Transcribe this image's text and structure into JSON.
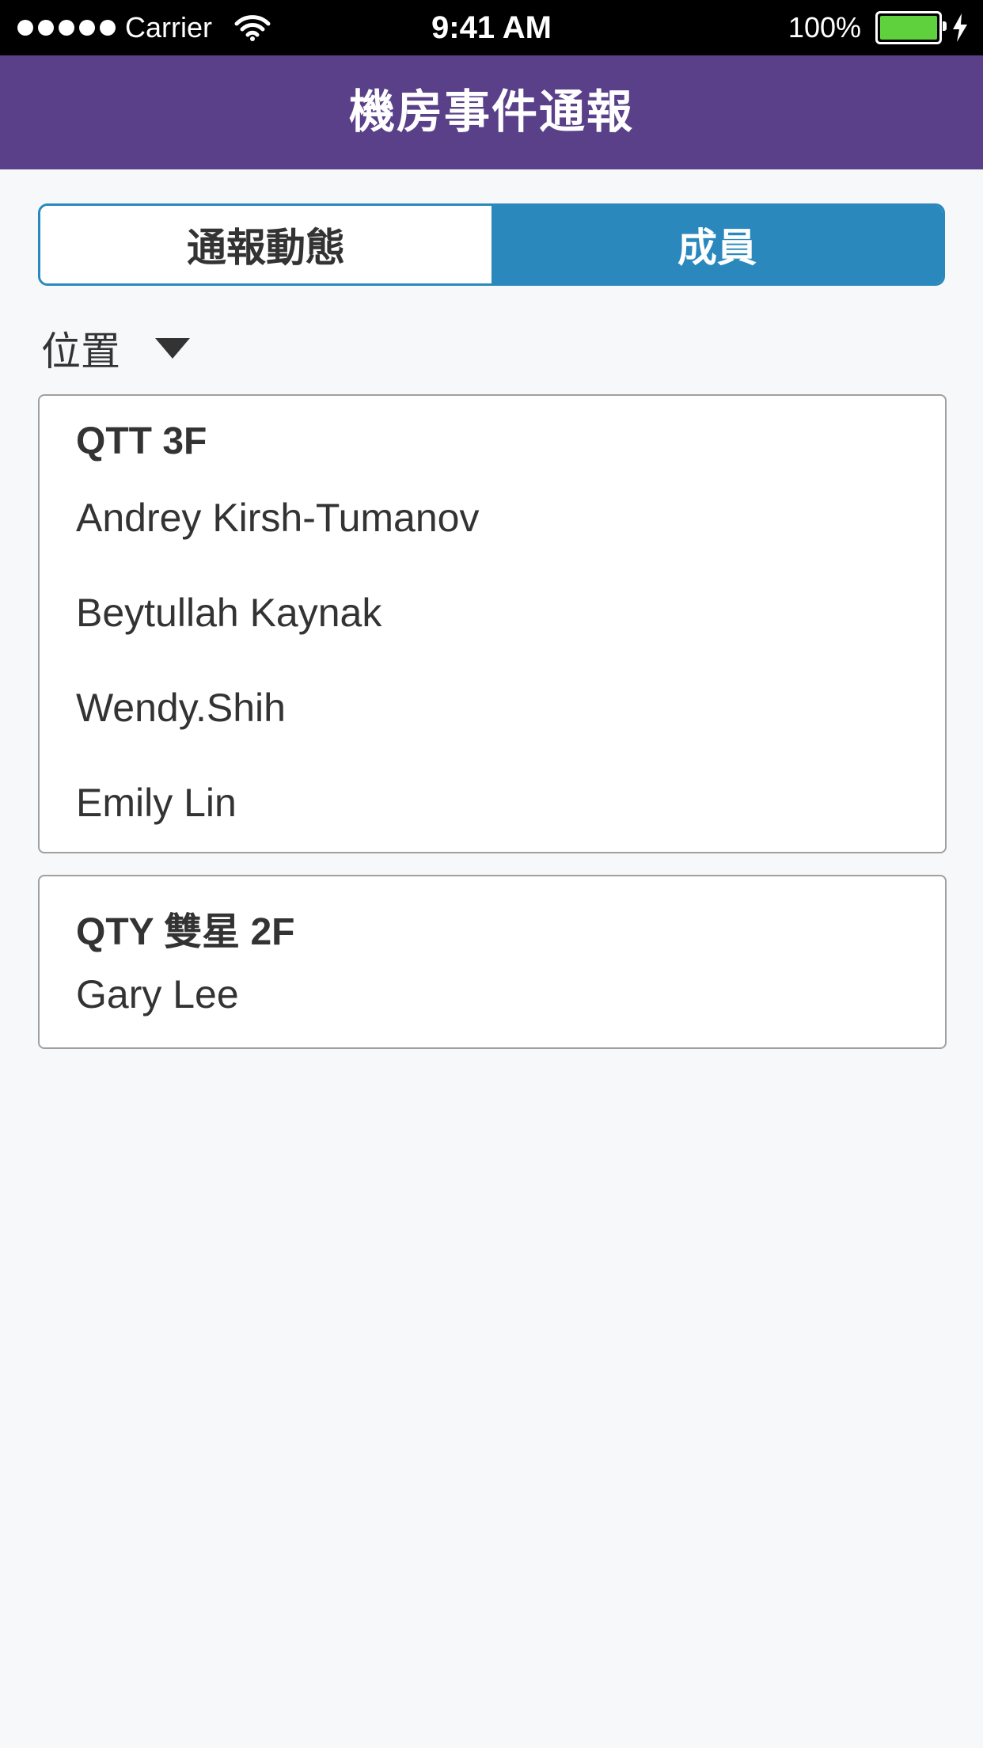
{
  "status_bar": {
    "carrier": "Carrier",
    "time": "9:41 AM",
    "battery": "100%",
    "battery_level": 1.0,
    "icons": [
      "signal-dots-icon",
      "wifi-icon",
      "battery-icon",
      "charging-bolt-icon"
    ]
  },
  "header": {
    "title": "機房事件通報"
  },
  "tabs": [
    {
      "label": "通報動態",
      "selected": false
    },
    {
      "label": "成員",
      "selected": true
    }
  ],
  "filter": {
    "label": "位置",
    "icon": "triangle-down-icon"
  },
  "groups": [
    {
      "title": "QTT 3F",
      "members": [
        "Andrey Kirsh-Tumanov",
        "Beytullah Kaynak",
        "Wendy.Shih",
        "Emily Lin"
      ]
    },
    {
      "title": "QTY 雙星 2F",
      "members": [
        "Gary Lee"
      ]
    }
  ],
  "colors": {
    "header_bg": "#594089",
    "accent": "#2a88bd",
    "page_bg": "#f7f8fa",
    "battery": "#5ed13d"
  }
}
